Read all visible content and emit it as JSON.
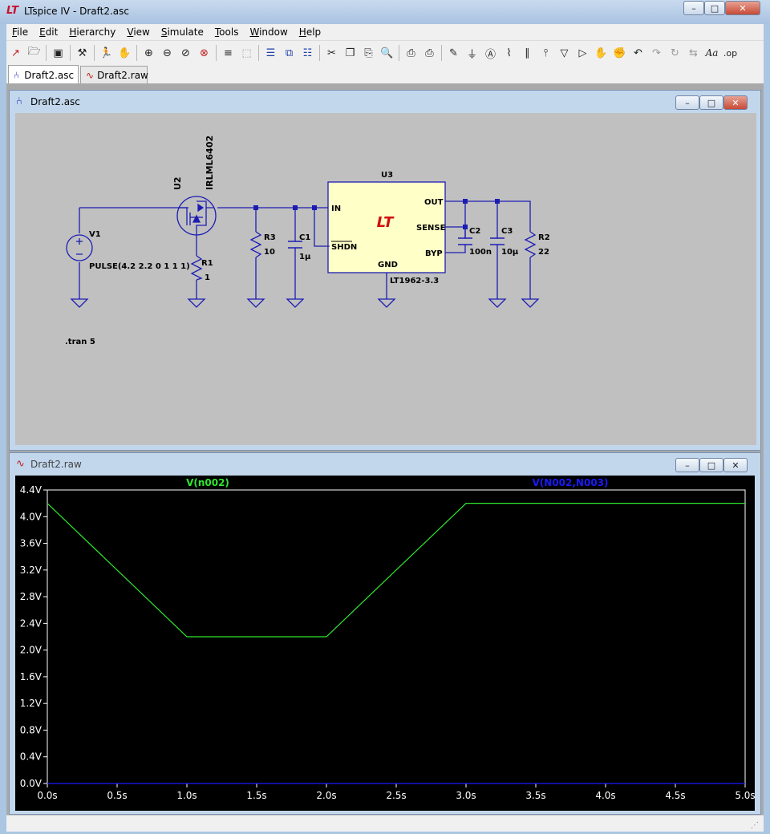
{
  "window": {
    "title": "LTspice IV - Draft2.asc",
    "logo": "LT",
    "controls": [
      "minimize-icon",
      "maximize-icon",
      "close-icon"
    ]
  },
  "menu": [
    "File",
    "Edit",
    "Hierarchy",
    "View",
    "Simulate",
    "Tools",
    "Window",
    "Help"
  ],
  "toolbar": {
    "icons": [
      "new-schematic-icon",
      "open-icon",
      "save-icon",
      "control-panel-icon",
      "run-icon",
      "halt-icon",
      "zoom-in-icon",
      "zoom-out-icon",
      "zoom-fit-icon",
      "zoom-cancel-icon",
      "plot-settings-icon",
      "autorange-icon",
      "tile-horizontal-icon",
      "cascade-icon",
      "tile-vertical-icon",
      "cut-icon",
      "copy-icon",
      "paste-icon",
      "find-icon",
      "print-preview-icon",
      "print-icon",
      "draw-wire-icon",
      "ground-icon",
      "label-net-icon",
      "resistor-icon",
      "capacitor-icon",
      "inductor-icon",
      "diode-icon",
      "component-icon",
      "move-icon",
      "drag-icon",
      "undo-icon",
      "redo-icon",
      "rotate-icon",
      "mirror-icon",
      "text-icon",
      "spice-directive-icon"
    ],
    "text_label": "Aa",
    "op_label": ".op"
  },
  "tabs": [
    {
      "label": "Draft2.asc",
      "icon": "schematic-icon"
    },
    {
      "label": "Draft2.raw",
      "icon": "waveform-icon"
    }
  ],
  "schematic_window": {
    "title": "Draft2.asc",
    "components": {
      "v1": {
        "ref": "V1",
        "value": "PULSE(4.2 2.2 0 1 1 1)"
      },
      "u2": {
        "ref": "U2",
        "part": "IRLML6402"
      },
      "r1": {
        "ref": "R1",
        "value": "1"
      },
      "r3": {
        "ref": "R3",
        "value": "10"
      },
      "c1": {
        "ref": "C1",
        "value": "1µ"
      },
      "u3": {
        "ref": "U3",
        "part": "LT1962-3.3",
        "pins": {
          "in": "IN",
          "shdn": "SHDN",
          "gnd": "GND",
          "out": "OUT",
          "sense": "SENSE",
          "byp": "BYP"
        }
      },
      "c2": {
        "ref": "C2",
        "value": "100n"
      },
      "c3": {
        "ref": "C3",
        "value": "10µ"
      },
      "r2": {
        "ref": "R2",
        "value": "22"
      }
    },
    "directive": ".tran 5"
  },
  "waveform_window": {
    "title": "Draft2.raw",
    "chart_data": {
      "type": "line",
      "title": "",
      "xlabel": "",
      "ylabel": "",
      "xlim": [
        0,
        5.0
      ],
      "ylim": [
        0,
        4.4
      ],
      "x_ticks": [
        "0.0s",
        "0.5s",
        "1.0s",
        "1.5s",
        "2.0s",
        "2.5s",
        "3.0s",
        "3.5s",
        "4.0s",
        "4.5s",
        "5.0s"
      ],
      "y_ticks": [
        "0.0V",
        "0.4V",
        "0.8V",
        "1.2V",
        "1.6V",
        "2.0V",
        "2.4V",
        "2.8V",
        "3.2V",
        "3.6V",
        "4.0V",
        "4.4V"
      ],
      "legend": "top",
      "series": [
        {
          "name": "V(n002)",
          "color": "#2ee82e",
          "x": [
            0,
            1,
            2,
            3,
            5
          ],
          "y": [
            4.2,
            2.2,
            2.2,
            4.2,
            4.2
          ]
        },
        {
          "name": "V(N002,N003)",
          "color": "#1a1aff",
          "x": [
            0,
            5
          ],
          "y": [
            0,
            0
          ]
        }
      ]
    }
  },
  "colors": {
    "wire": "#1c1cb4",
    "component": "#1c1cb4",
    "schematic_bg": "#c0c0c0",
    "plot_bg": "#000000",
    "lt_logo": "#d01010"
  }
}
